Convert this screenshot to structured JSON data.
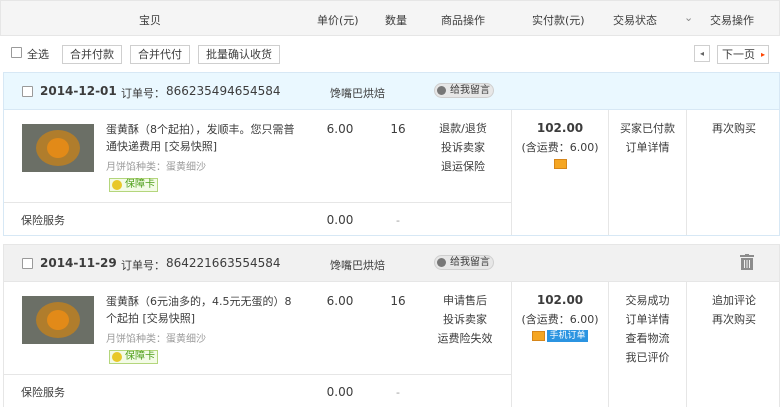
{
  "header": {
    "item": "宝贝",
    "unit_price": "单价(元)",
    "quantity": "数量",
    "item_ops": "商品操作",
    "paid": "实付款(元)",
    "status": "交易状态",
    "status_arrow": "⌄",
    "trade_ops": "交易操作"
  },
  "toolbar": {
    "select_all": "全选",
    "merge_pay": "合并付款",
    "merge_proxy": "合并代付",
    "batch_confirm": "批量确认收货",
    "prev_arrow": "◂",
    "next_label": "下一页",
    "next_arrow": "▸"
  },
  "orders": [
    {
      "date": "2014-12-01",
      "order_no_label": "订单号：",
      "order_no": "866235494654584",
      "shop": "馋嘴巴烘焙",
      "message": "给我留言",
      "title": "蛋黄酥（8个起拍），发顺丰。您只需普通快递费用 [交易快照]",
      "spec": "月饼馅种类：蛋黄细沙",
      "badge": "保障卡",
      "unit_price": "6.00",
      "quantity": "16",
      "item_ops": [
        "退款/退货",
        "投诉卖家",
        "退运保险"
      ],
      "total": "102.00",
      "shipping": "(含运费：6.00)",
      "status": [
        "买家已付款",
        "订单详情"
      ],
      "trade_ops": [
        "再次购买"
      ],
      "service_label": "保险服务",
      "service_price": "0.00",
      "service_qty": "-"
    },
    {
      "date": "2014-11-29",
      "order_no_label": "订单号：",
      "order_no": "864221663554584",
      "shop": "馋嘴巴烘焙",
      "message": "给我留言",
      "title": "蛋黄酥（6元油多的，4.5元无蛋的）8个起拍 [交易快照]",
      "spec": "月饼馅种类：蛋黄细沙",
      "badge": "保障卡",
      "unit_price": "6.00",
      "quantity": "16",
      "item_ops": [
        "申请售后",
        "投诉卖家",
        "运费险失效"
      ],
      "total": "102.00",
      "shipping": "(含运费：6.00)",
      "mobile_order": "手机订单",
      "status": [
        "交易成功",
        "订单详情",
        "查看物流",
        "我已评价"
      ],
      "trade_ops": [
        "追加评论",
        "再次购买"
      ],
      "service_label": "保险服务",
      "service_price": "0.00",
      "service_qty": "-"
    }
  ],
  "icons": {
    "message": "speech-bubble-icon",
    "badge": "shield-icon",
    "payment": "card-icon",
    "delete": "trash-icon"
  },
  "colors": {
    "order_head_active": "#eaf8ff",
    "badge_green": "#4e9f1a",
    "mobile_blue": "#2b94e1",
    "payment_orange": "#f5a623"
  }
}
